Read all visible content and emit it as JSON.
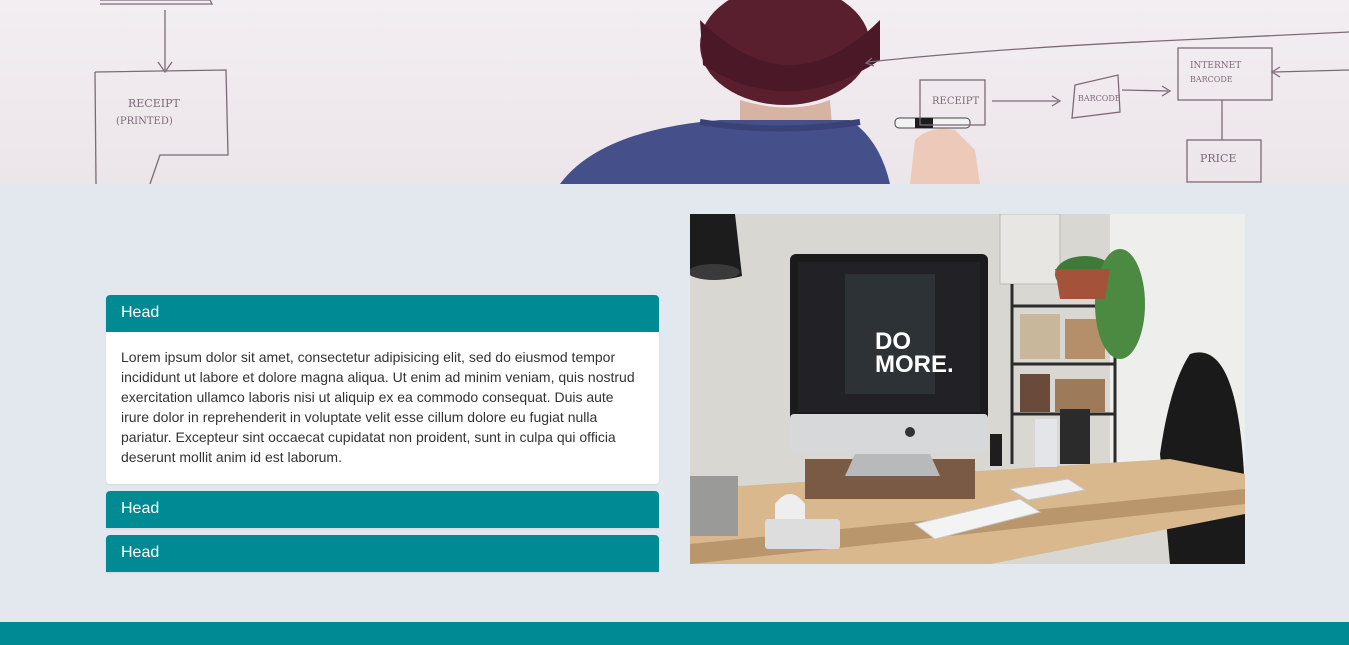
{
  "hero": {
    "image_alt": "person writing a flowchart on a whiteboard",
    "sketch_labels": [
      "RECEIPT",
      "(PRINTED)",
      "RECEIPT",
      "BARCODE",
      "INTERNET",
      "BARCODE",
      "PRICE"
    ]
  },
  "accordion": {
    "panels": [
      {
        "head": "Head",
        "body": "Lorem ipsum dolor sit amet, consectetur adipisicing elit, sed do eiusmod tempor incididunt ut labore et dolore magna aliqua. Ut enim ad minim veniam, quis nostrud exercitation ullamco laboris nisi ut aliquip ex ea commodo consequat. Duis aute irure dolor in reprehenderit in voluptate velit esse cillum dolore eu fugiat nulla pariatur. Excepteur sint occaecat cupidatat non proident, sunt in culpa qui officia deserunt mollit anim id est laborum.",
        "expanded": true
      },
      {
        "head": "Head",
        "expanded": false
      },
      {
        "head": "Head",
        "expanded": false
      }
    ]
  },
  "photo": {
    "alt": "iMac on a wooden desk",
    "screen_text_line1": "DO",
    "screen_text_line2": "MORE."
  },
  "colors": {
    "accent": "#008b94",
    "section_bg": "#e3e8ef",
    "body_text": "#333333"
  }
}
